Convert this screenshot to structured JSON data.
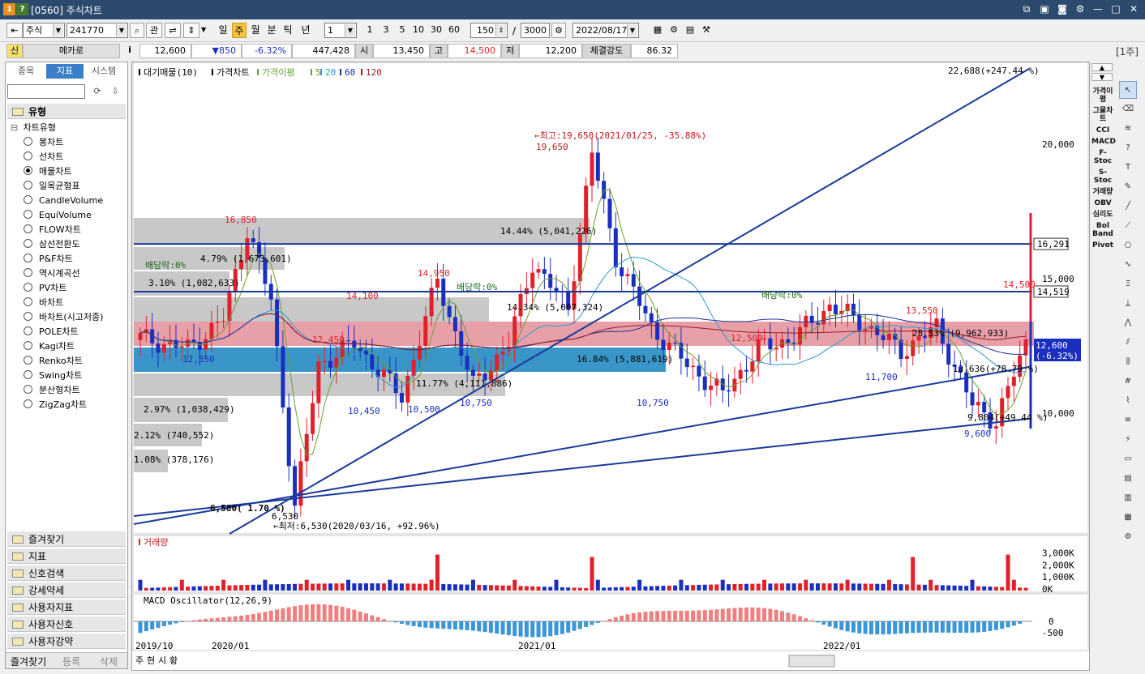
{
  "window": {
    "number_badge": "1",
    "help_badge": "?",
    "title": "[0560] 주식차트"
  },
  "toolbar": {
    "market": "주식",
    "code": "241770",
    "buttons": {
      "gwan": "관"
    },
    "periods": [
      "일",
      "주",
      "월",
      "분",
      "틱",
      "년"
    ],
    "active_period": "주",
    "interval_value": "1",
    "intervals": [
      "1",
      "3",
      "5",
      "10",
      "30",
      "60"
    ],
    "count": "150",
    "slash": "/",
    "total": "3000",
    "date": "2022/08/17"
  },
  "quote": {
    "new_badge": "신",
    "name": "메카로",
    "info": "i",
    "price": "12,600",
    "change": "▼850",
    "change_pct": "-6.32%",
    "volume": "447,428",
    "open_label": "시",
    "open": "13,450",
    "high_label": "고",
    "high": "14,500",
    "low_label": "저",
    "low": "12,200",
    "strength_label": "체결강도",
    "strength": "86.32",
    "unit": "[1주]"
  },
  "left": {
    "tabs": [
      "종목",
      "지표",
      "시스템"
    ],
    "active_tab": "지표",
    "section": "유형",
    "tree_root": "차트유형",
    "chart_types": [
      "봉차트",
      "선차트",
      "매물차트",
      "일목균형표",
      "CandleVolume",
      "EquiVolume",
      "FLOW차트",
      "삼선전환도",
      "P&F차트",
      "역시계곡선",
      "PV차트",
      "바차트",
      "바차트(시고저종)",
      "POLE차트",
      "Kagi차트",
      "Renko차트",
      "Swing차트",
      "분산형차트",
      "ZigZag차트"
    ],
    "selected_type": "매물차트",
    "folders": [
      "즐겨찾기",
      "지표",
      "신호검색",
      "강세약세",
      "사용자지표",
      "사용자신호",
      "사용자강약"
    ],
    "bottom_tabs": [
      "즐겨찾기",
      "등록",
      "삭제"
    ]
  },
  "chart": {
    "legend": {
      "main": "대기매물(10)",
      "price": "가격차트",
      "ma_label": "가격이평",
      "ma5": "5",
      "ma20": "20",
      "ma60": "60",
      "ma120": "120"
    },
    "colors": {
      "up": "#e0202a",
      "down": "#1a2fc0",
      "ma5": "#6aa02a",
      "ma20": "#2a9ad0",
      "ma60": "#1a2f9a",
      "ma120": "#9a1a2a",
      "trend": "#1a3a9a",
      "profile_gray": "#c8c8c8",
      "profile_red": "#e8a0a8",
      "profile_blue": "#3a96c8"
    },
    "y_ticks": [
      "20,000",
      "15,000",
      "10,000"
    ],
    "price_boxes": {
      "upper": "16,291",
      "mid": "14,519",
      "current": "12,600",
      "current_pct": "(-6.32%)"
    },
    "annotations": {
      "high": "←최고:19,650(2021/01/25, -35.88%)",
      "high_val": "19,650",
      "low": "←최저:6,530(2020/03/16, +92.96%)",
      "low_val": "6,530",
      "top_right": "22,688(+247.44 %)",
      "bot_right": "9,804(+49.44 %)",
      "mid_right": "13,636(+78.79 %)",
      "low_left": "6,580( 1.70 %)",
      "div1": "배당락:0%",
      "div2": "배당락:0%",
      "div3": "배당락:0%",
      "labels": [
        "16,850",
        "12,350",
        "14,100",
        "14,950",
        "12,450",
        "10,450",
        "10,500",
        "10,750",
        "12,500",
        "10,750",
        "13,550",
        "11,700",
        "14,500",
        "9,600"
      ]
    },
    "profile_labels": [
      "14.44% (5,041,226)",
      "4.79% (1,673,601)",
      "3.10% (1,082,633)",
      "14.34% (5,007,324)",
      "16.84% (5,881,619)",
      "11.77% (4,111,886)",
      "28.53% (9,962,933)",
      "2.97% (1,038,429)",
      "2.12% (740,552)",
      "1.08% (378,176)"
    ],
    "volume_title": "거래량",
    "volume_ticks": [
      "3,000K",
      "2,000K",
      "1,000K",
      "0K"
    ],
    "macd_title": "MACD Oscillator(12,26,9)",
    "macd_ticks": [
      "0",
      "-500"
    ],
    "x_labels": [
      "2019/10",
      "2020/01",
      "2021/01",
      "2022/01"
    ]
  },
  "bottom_tabs": [
    "주",
    "현",
    "시",
    "황"
  ],
  "right_indicators": [
    "가격이평",
    "그물차트",
    "CCI",
    "MACD",
    "F-Stoc",
    "S-Stoc",
    "거래량",
    "OBV",
    "심리도",
    "Bol Band",
    "Pivot"
  ]
}
